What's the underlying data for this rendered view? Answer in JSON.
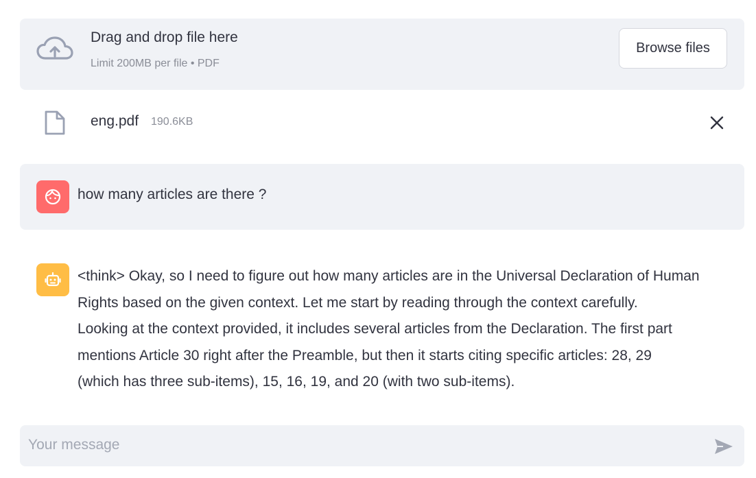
{
  "uploader": {
    "title": "Drag and drop file here",
    "subtitle": "Limit 200MB per file • PDF",
    "browse_label": "Browse files",
    "icon": "cloud-upload-icon"
  },
  "file": {
    "name": "eng.pdf",
    "size": "190.6KB",
    "icon": "file-icon"
  },
  "messages": [
    {
      "role": "user",
      "text": "how many articles are there ?"
    },
    {
      "role": "assistant",
      "lines": [
        "<think> Okay, so I need to figure out how many articles are in the Universal Declaration of Human",
        "Rights based on the given context. Let me start by reading through the context carefully.",
        "Looking at the context provided, it includes several articles from the Declaration. The first part",
        "mentions Article 30 right after the Preamble, but then it starts citing specific articles: 28, 29",
        "(which has three sub-items), 15, 16, 19, and 20 (with two sub-items)."
      ]
    }
  ],
  "chat_input": {
    "placeholder": "Your message"
  },
  "colors": {
    "user_avatar": "#ff6b6b",
    "bot_avatar": "#ffbd45",
    "panel_bg": "#f0f2f6"
  }
}
